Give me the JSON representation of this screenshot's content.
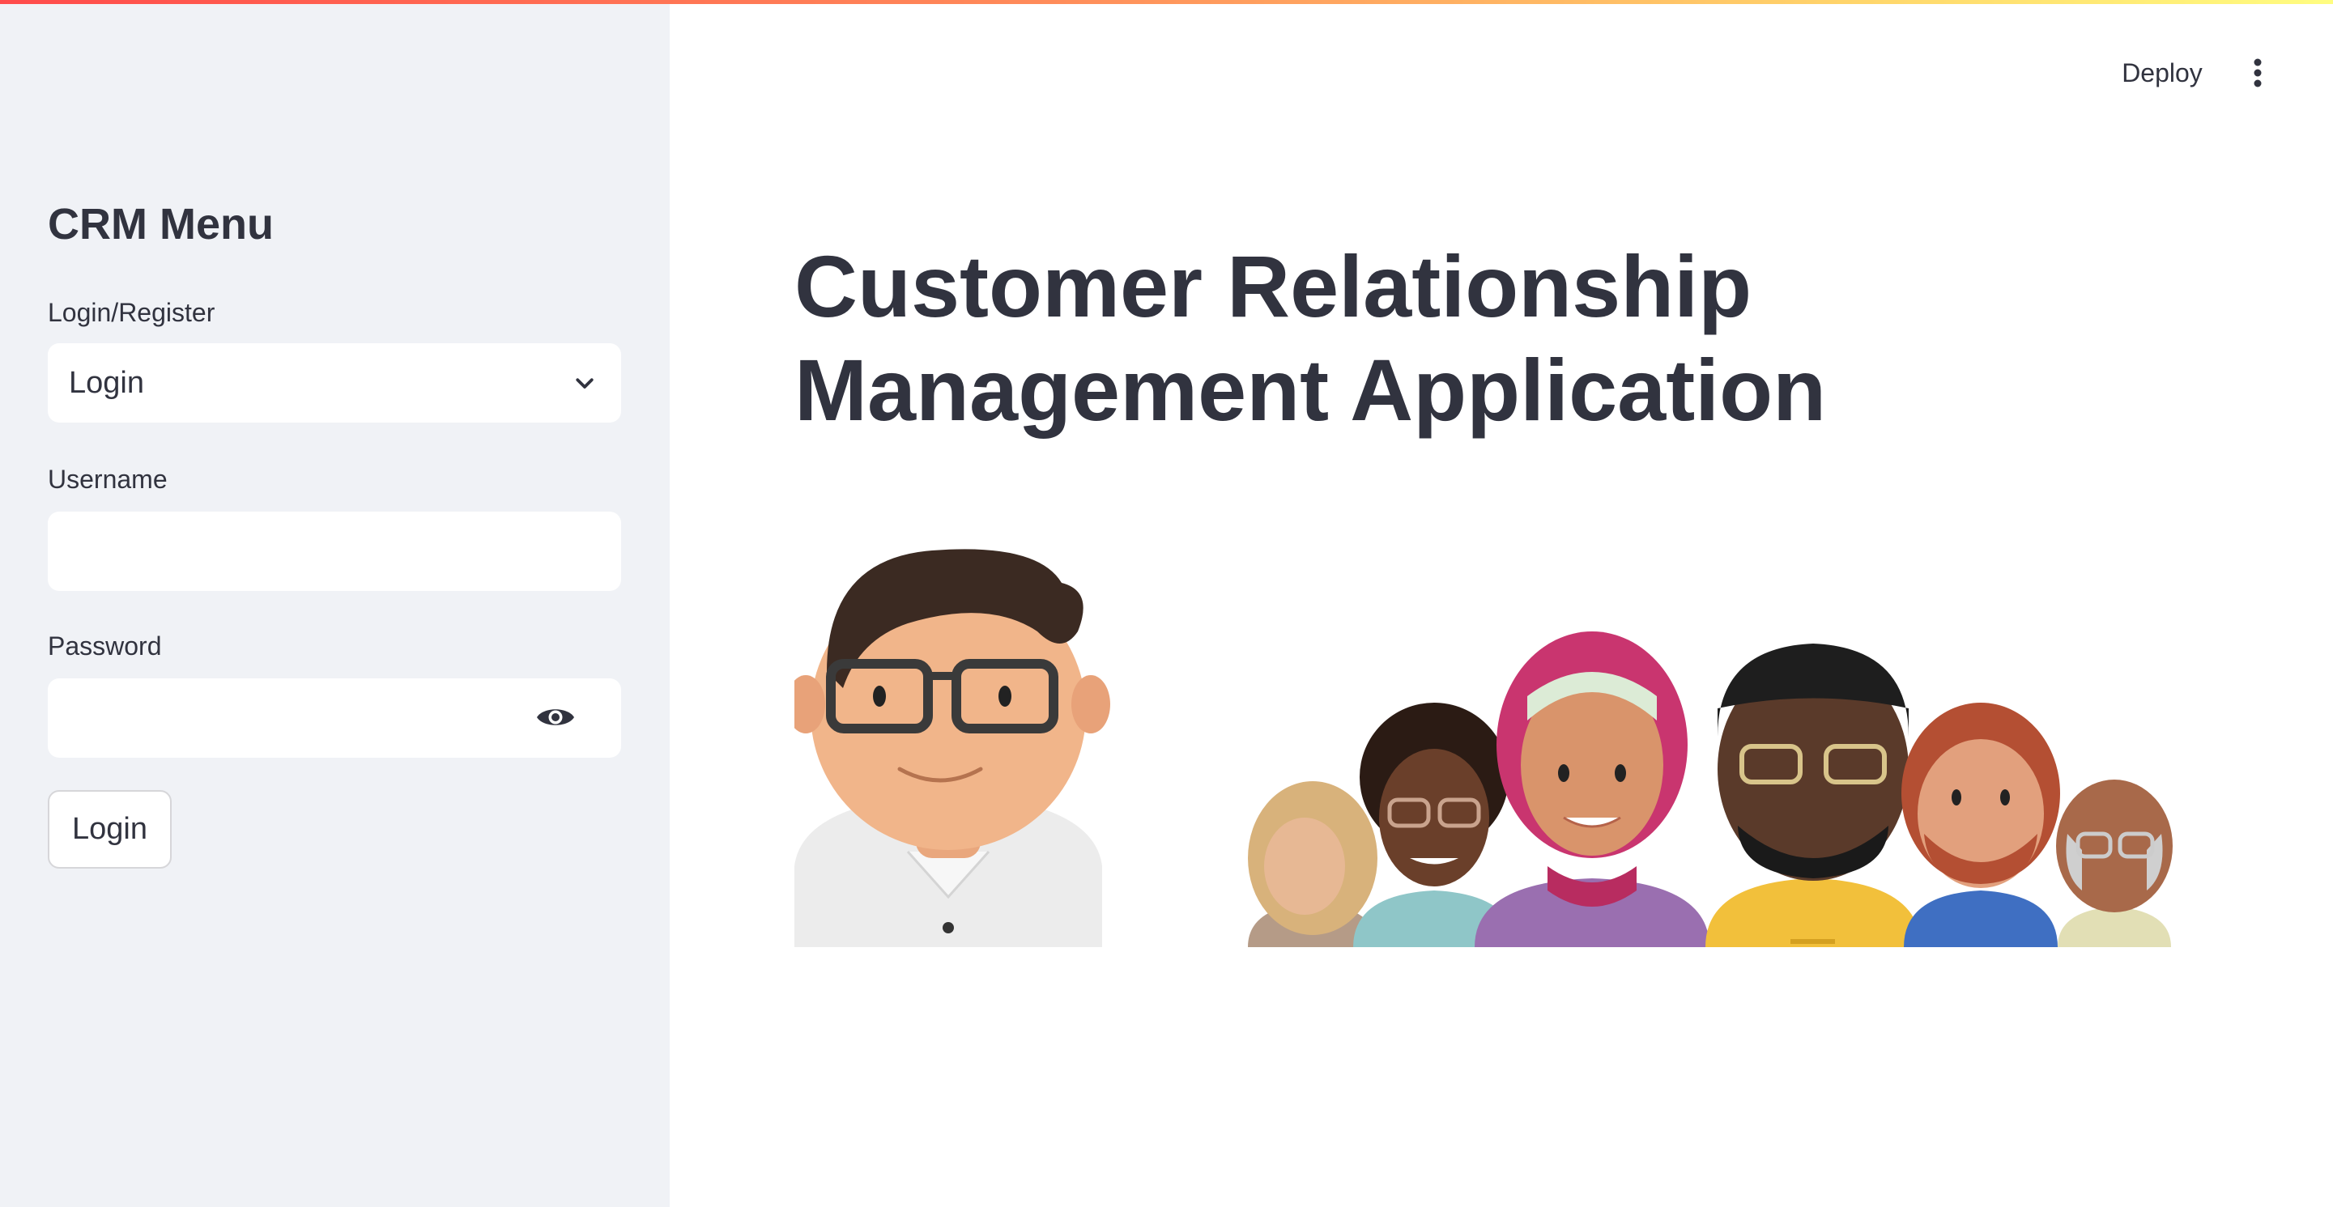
{
  "sidebar": {
    "title": "CRM Menu",
    "mode_label": "Login/Register",
    "mode_selected": "Login",
    "username_label": "Username",
    "username_value": "",
    "password_label": "Password",
    "password_value": "",
    "submit_label": "Login"
  },
  "header": {
    "deploy_label": "Deploy"
  },
  "main": {
    "title": "Customer Relationship Management Application"
  },
  "colors": {
    "sidebar_bg": "#f0f2f6",
    "text": "#31333f",
    "accent_gradient": [
      "#ff4b4b",
      "#fffd80"
    ]
  },
  "icons": {
    "select": "chevron-down-icon",
    "password_toggle": "eye-icon",
    "menu": "kebab-menu-icon"
  }
}
